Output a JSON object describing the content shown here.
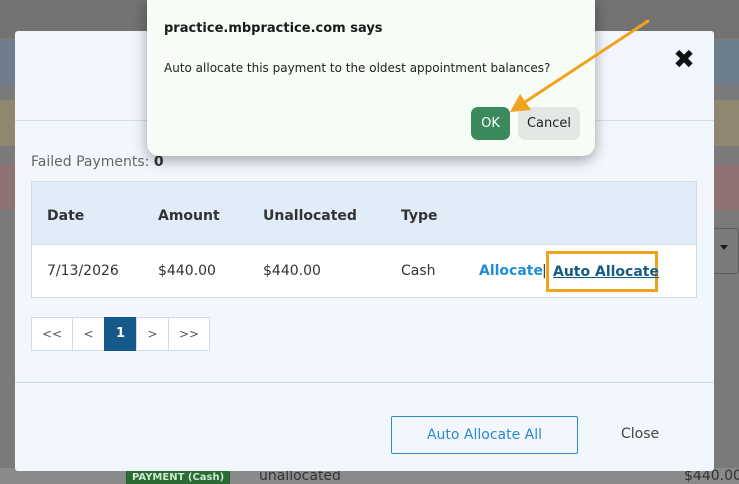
{
  "background": {
    "bottom_badge": "PAYMENT (Cash)",
    "bottom_status": "unallocated",
    "bottom_amount": "$440.00"
  },
  "modal": {
    "close_glyph": "✖",
    "failed_label": "Failed Payments:",
    "failed_count": "0",
    "table": {
      "headers": [
        "Date",
        "Amount",
        "Unallocated",
        "Type"
      ],
      "rows": [
        {
          "date": "7/13/2026",
          "amount": "$440.00",
          "unallocated": "$440.00",
          "type": "Cash",
          "allocate": "Allocate",
          "separator": "|",
          "auto_allocate": "Auto Allocate"
        }
      ]
    },
    "pager": [
      "<<",
      "<",
      "1",
      ">",
      ">>"
    ],
    "current_page": "1",
    "auto_allocate_all": "Auto Allocate All",
    "close": "Close"
  },
  "dialog": {
    "title": "practice.mbpractice.com says",
    "message": "Auto allocate this payment to the oldest appointment balances?",
    "ok": "OK",
    "cancel": "Cancel"
  },
  "colors": {
    "highlight": "#f2a31d",
    "ok_button": "#3a8a5e",
    "link": "#1f8ed6",
    "page_active": "#14598a"
  }
}
